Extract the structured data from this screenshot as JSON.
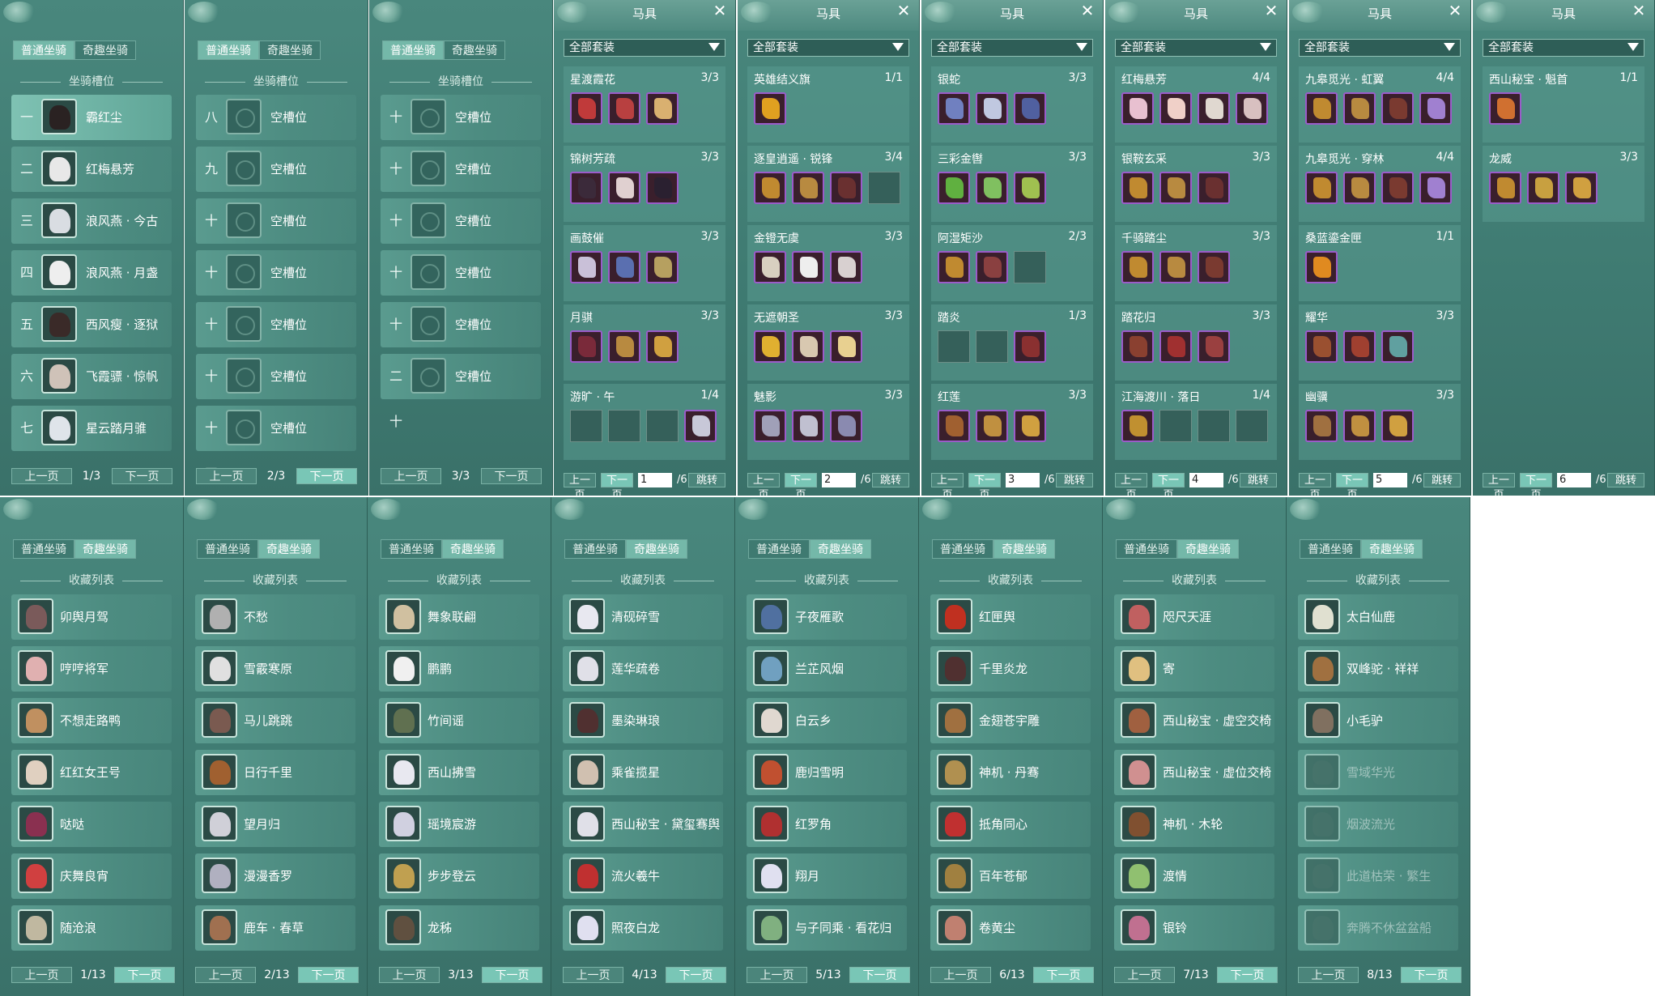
{
  "tabs": {
    "normal": "普通坐骑",
    "fun": "奇趣坐骑"
  },
  "slot_panels": {
    "section_title": "坐骑槽位",
    "prev": "上一页",
    "next": "下一页",
    "pages": [
      {
        "page": "1/3",
        "rows": [
          {
            "num": "一",
            "name": "霸红尘",
            "color": "#2a2222",
            "selected": true
          },
          {
            "num": "二",
            "name": "红梅悬芳",
            "color": "#e8e8e8"
          },
          {
            "num": "三",
            "name": "浪风燕 · 今古",
            "color": "#d9dde2"
          },
          {
            "num": "四",
            "name": "浪风燕 · 月盏",
            "color": "#eeeeee"
          },
          {
            "num": "五",
            "name": "西风瘦 · 逐狱",
            "color": "#3a2a28"
          },
          {
            "num": "六",
            "name": "飞霞骠 · 惊帆",
            "color": "#cfc2b8"
          },
          {
            "num": "七",
            "name": "星云踏月骓",
            "color": "#dfe4ea"
          }
        ]
      },
      {
        "page": "2/3",
        "rows": [
          {
            "num": "八",
            "name": "空槽位"
          },
          {
            "num": "九",
            "name": "空槽位"
          },
          {
            "num": "十",
            "name": "空槽位"
          },
          {
            "num": "十一",
            "name": "空槽位"
          },
          {
            "num": "十二",
            "name": "空槽位"
          },
          {
            "num": "十三",
            "name": "空槽位"
          },
          {
            "num": "十四",
            "name": "空槽位"
          }
        ]
      },
      {
        "page": "3/3",
        "rows": [
          {
            "num": "十五",
            "name": "空槽位"
          },
          {
            "num": "十六",
            "name": "空槽位"
          },
          {
            "num": "十七",
            "name": "空槽位"
          },
          {
            "num": "十八",
            "name": "空槽位"
          },
          {
            "num": "十九",
            "name": "空槽位"
          },
          {
            "num": "二十",
            "name": "空槽位"
          }
        ]
      }
    ]
  },
  "saddle_panels": {
    "title": "马具",
    "filter": "全部套装",
    "prev": "上一页",
    "next": "下一页",
    "jump": "跳转",
    "total": "/6",
    "pages": [
      {
        "page": "1",
        "sets": [
          {
            "name": "星渡霞花",
            "count": "3/3",
            "items": [
              "#c03a3a",
              "#b84040",
              "#d9b070"
            ]
          },
          {
            "name": "锦树芳疏",
            "count": "3/3",
            "items": [
              "#3b2a3a",
              "#e0d0d0",
              "#2a2030"
            ]
          },
          {
            "name": "画鼓催",
            "count": "3/3",
            "items": [
              "#c9c0d8",
              "#5a6fb0",
              "#b6a060"
            ]
          },
          {
            "name": "月骐",
            "count": "3/3",
            "items": [
              "#7a2a3a",
              "#b88a40",
              "#d0a040"
            ]
          },
          {
            "name": "游旷 · 午",
            "count": "1/4",
            "items": [
              "",
              "",
              "",
              "#c8c8d8"
            ]
          }
        ]
      },
      {
        "page": "2",
        "sets": [
          {
            "name": "英雄结义旗",
            "count": "1/1",
            "items": [
              "#e0a020"
            ]
          },
          {
            "name": "逐皇逍遥 · 锐锋",
            "count": "3/4",
            "items": [
              "#c08a30",
              "#b88a40",
              "#6a3030",
              ""
            ]
          },
          {
            "name": "金镫无虞",
            "count": "3/3",
            "items": [
              "#d8d0c0",
              "#eeeeee",
              "#d8d0d0"
            ]
          },
          {
            "name": "无遮朝圣",
            "count": "3/3",
            "items": [
              "#e0b030",
              "#d8c8b0",
              "#e8d090"
            ]
          },
          {
            "name": "魅影",
            "count": "3/3",
            "items": [
              "#a0a0b8",
              "#c0c0d0",
              "#8a8ab0"
            ]
          }
        ]
      },
      {
        "page": "3",
        "sets": [
          {
            "name": "银蛇",
            "count": "3/3",
            "items": [
              "#7080c0",
              "#c0c8e0",
              "#5060a0"
            ]
          },
          {
            "name": "三彩金辔",
            "count": "3/3",
            "items": [
              "#60b040",
              "#80c060",
              "#a0c050"
            ]
          },
          {
            "name": "阿湿矩沙",
            "count": "2/3",
            "items": [
              "#c08a30",
              "#8a4040",
              ""
            ]
          },
          {
            "name": "踏炎",
            "count": "1/3",
            "items": [
              "",
              "",
              "#8a3030"
            ]
          },
          {
            "name": "红莲",
            "count": "3/3",
            "items": [
              "#a06030",
              "#c09040",
              "#d0a040"
            ]
          }
        ]
      },
      {
        "page": "4",
        "sets": [
          {
            "name": "红梅悬芳",
            "count": "4/4",
            "items": [
              "#e8c0d0",
              "#f0d0c8",
              "#e0d8d0",
              "#d8c0c0"
            ]
          },
          {
            "name": "银鞍玄采",
            "count": "3/3",
            "items": [
              "#c08a30",
              "#b88a40",
              "#6a3030"
            ]
          },
          {
            "name": "千骑踏尘",
            "count": "3/3",
            "items": [
              "#c08a30",
              "#b88a40",
              "#7a3a30"
            ]
          },
          {
            "name": "踏花归",
            "count": "3/3",
            "items": [
              "#8a4030",
              "#a03030",
              "#9a4040"
            ]
          },
          {
            "name": "江海渡川 · 落日",
            "count": "1/4",
            "items": [
              "#c09030",
              "",
              "",
              ""
            ]
          }
        ]
      },
      {
        "page": "5",
        "sets": [
          {
            "name": "九皋觅光 · 虹翼",
            "count": "4/4",
            "items": [
              "#c08a30",
              "#b88a40",
              "#7a3a30",
              "#a080d0"
            ]
          },
          {
            "name": "九皋觅光 · 穿林",
            "count": "4/4",
            "items": [
              "#c08a30",
              "#b88a40",
              "#7a3a30",
              "#a080d0"
            ]
          },
          {
            "name": "桑蓝鎏金匣",
            "count": "1/1",
            "items": [
              "#e08a20"
            ]
          },
          {
            "name": "耀华",
            "count": "3/3",
            "items": [
              "#9a5030",
              "#a04030",
              "#60a0a0"
            ]
          },
          {
            "name": "幽骥",
            "count": "3/3",
            "items": [
              "#a07040",
              "#c09040",
              "#d0a040"
            ]
          }
        ]
      },
      {
        "page": "6",
        "sets": [
          {
            "name": "西山秘宝 · 魁首",
            "count": "1/1",
            "items": [
              "#d07030"
            ]
          },
          {
            "name": "龙威",
            "count": "3/3",
            "items": [
              "#c08a30",
              "#c8a040",
              "#d0a040"
            ]
          }
        ]
      }
    ]
  },
  "collection_panels": {
    "section_title": "收藏列表",
    "prev": "上一页",
    "next": "下一页",
    "pages": [
      {
        "page": "1/13",
        "items": [
          {
            "name": "卯舆月驾",
            "color": "#7a5a5a"
          },
          {
            "name": "哼哼将军",
            "color": "#e0b0b0"
          },
          {
            "name": "不想走路鸭",
            "color": "#c09060"
          },
          {
            "name": "红红女王号",
            "color": "#e0d0c0"
          },
          {
            "name": "哒哒",
            "color": "#8a3050"
          },
          {
            "name": "庆舞良宵",
            "color": "#d04040"
          },
          {
            "name": "随沧浪",
            "color": "#c0b8a0"
          }
        ]
      },
      {
        "page": "2/13",
        "items": [
          {
            "name": "不愁",
            "color": "#b0b0b0"
          },
          {
            "name": "雪霰寒原",
            "color": "#e0e0e0"
          },
          {
            "name": "马儿跳跳",
            "color": "#7a5a50"
          },
          {
            "name": "日行千里",
            "color": "#a06030"
          },
          {
            "name": "望月归",
            "color": "#d0d0d8"
          },
          {
            "name": "漫漫香罗",
            "color": "#b0b0c0"
          },
          {
            "name": "鹿车 · 春草",
            "color": "#a07050"
          }
        ]
      },
      {
        "page": "3/13",
        "items": [
          {
            "name": "舞象联翩",
            "color": "#d0c0a0"
          },
          {
            "name": "鹏鹏",
            "color": "#f0f0f0"
          },
          {
            "name": "竹间谣",
            "color": "#607050"
          },
          {
            "name": "西山拂雪",
            "color": "#e8e8f0"
          },
          {
            "name": "瑶境宸游",
            "color": "#d0d0e0"
          },
          {
            "name": "步步登云",
            "color": "#c0a050"
          },
          {
            "name": "龙秭",
            "color": "#605040"
          }
        ]
      },
      {
        "page": "4/13",
        "items": [
          {
            "name": "清砚碎雪",
            "color": "#e8e8f0"
          },
          {
            "name": "莲华疏卷",
            "color": "#e0e0e8"
          },
          {
            "name": "墨染琳琅",
            "color": "#503030"
          },
          {
            "name": "乘雀揽星",
            "color": "#d0c0b0"
          },
          {
            "name": "西山秘宝 · 黛玺骞舆",
            "color": "#e0e0e8"
          },
          {
            "name": "流火羲牛",
            "color": "#c03030"
          },
          {
            "name": "照夜白龙",
            "color": "#e0e0f0"
          }
        ]
      },
      {
        "page": "5/13",
        "items": [
          {
            "name": "子夜雁歌",
            "color": "#5070a0"
          },
          {
            "name": "兰芷风烟",
            "color": "#70a0c0"
          },
          {
            "name": "白云乡",
            "color": "#e0d8d0"
          },
          {
            "name": "鹿归雪明",
            "color": "#c05030"
          },
          {
            "name": "红罗角",
            "color": "#b03030"
          },
          {
            "name": "翔月",
            "color": "#e0e0f0"
          },
          {
            "name": "与子同乘 · 看花归",
            "color": "#80b080"
          }
        ]
      },
      {
        "page": "6/13",
        "items": [
          {
            "name": "红匣舆",
            "color": "#c03020"
          },
          {
            "name": "千里炎龙",
            "color": "#503030"
          },
          {
            "name": "金翅苍宇雕",
            "color": "#a07040"
          },
          {
            "name": "神机 · 丹骞",
            "color": "#b09050"
          },
          {
            "name": "抵角同心",
            "color": "#c03030"
          },
          {
            "name": "百年苍郁",
            "color": "#a08040"
          },
          {
            "name": "卷黄尘",
            "color": "#c08070"
          }
        ]
      },
      {
        "page": "7/13",
        "items": [
          {
            "name": "咫尺天涯",
            "color": "#c06060"
          },
          {
            "name": "寄",
            "color": "#e0c080"
          },
          {
            "name": "西山秘宝 · 虚空交椅",
            "color": "#a06040"
          },
          {
            "name": "西山秘宝 · 虚位交椅",
            "color": "#d09090"
          },
          {
            "name": "神机 · 木轮",
            "color": "#805030"
          },
          {
            "name": "渡情",
            "color": "#90c070"
          },
          {
            "name": "银铃",
            "color": "#c07090"
          }
        ]
      },
      {
        "page": "8/13",
        "items": [
          {
            "name": "太白仙鹿",
            "color": "#e0e0d0"
          },
          {
            "name": "双峰驼 · 祥祥",
            "color": "#a07040"
          },
          {
            "name": "小毛驴",
            "color": "#807060"
          },
          {
            "name": "雪域华光",
            "color": "#354f4a",
            "dim": true
          },
          {
            "name": "烟波流光",
            "color": "#354f4a",
            "dim": true
          },
          {
            "name": "此道枯荣 · 繁生",
            "color": "#354f4a",
            "dim": true
          },
          {
            "name": "奔腾不休盆盆船",
            "color": "#354f4a",
            "dim": true
          }
        ]
      }
    ]
  }
}
